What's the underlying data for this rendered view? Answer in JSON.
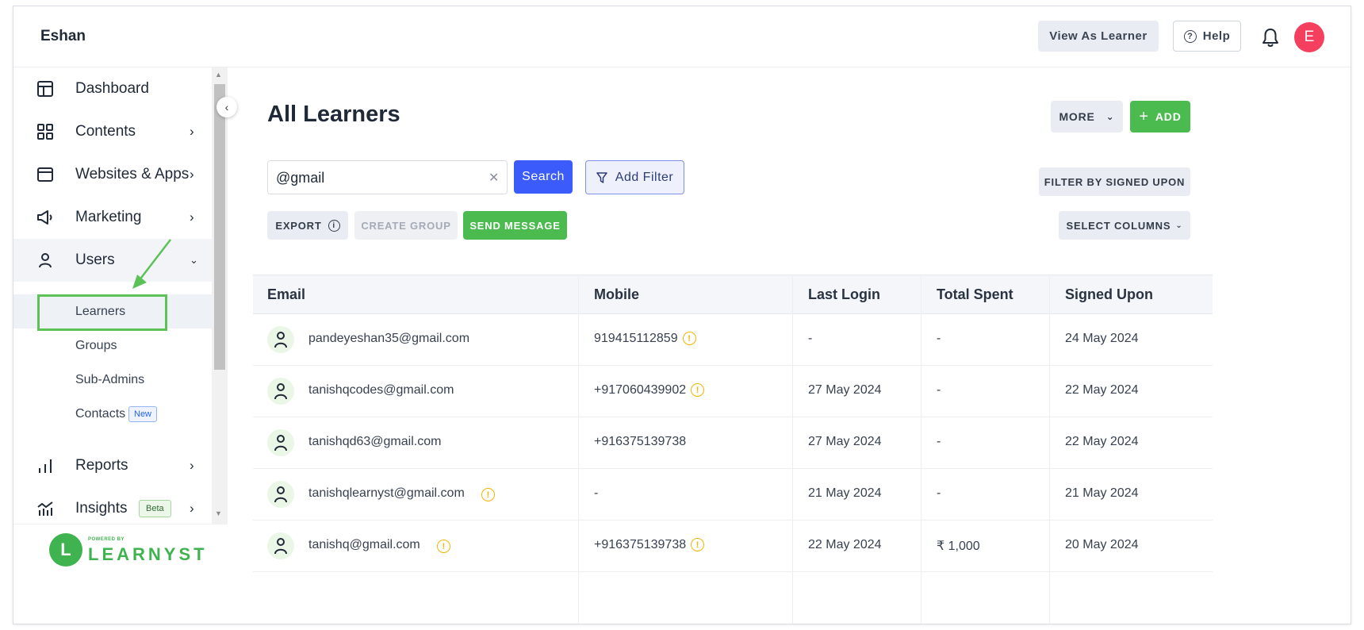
{
  "topbar": {
    "brand": "Eshan",
    "view_as_learner": "View As Learner",
    "help": "Help",
    "avatar_letter": "E"
  },
  "sidebar": {
    "items": [
      {
        "label": "Dashboard",
        "icon": "layout-icon"
      },
      {
        "label": "Contents",
        "icon": "grid-icon"
      },
      {
        "label": "Websites & Apps",
        "icon": "browser-icon"
      },
      {
        "label": "Marketing",
        "icon": "megaphone-icon"
      },
      {
        "label": "Users",
        "icon": "user-icon"
      },
      {
        "label": "Reports",
        "icon": "bar-chart-icon"
      },
      {
        "label": "Insights",
        "icon": "insights-icon"
      }
    ],
    "users_sub": [
      "Learners",
      "Groups",
      "Sub-Admins",
      "Contacts"
    ],
    "new_badge": "New",
    "beta_badge": "Beta",
    "powered_by": "POWERED BY",
    "logo_text": "LEARNYST",
    "logo_letter": "L"
  },
  "main": {
    "title": "All Learners",
    "more_label": "MORE",
    "add_label": "ADD",
    "search_value": "@gmail",
    "search_button": "Search",
    "add_filter": "Add Filter",
    "filter_by_signed": "FILTER BY SIGNED UPON",
    "export": "EXPORT",
    "create_group": "CREATE GROUP",
    "send_message": "SEND MESSAGE",
    "select_columns": "SELECT COLUMNS"
  },
  "table": {
    "headers": [
      "Email",
      "Mobile",
      "Last Login",
      "Total Spent",
      "Signed Upon"
    ],
    "rows": [
      {
        "email": "pandeyeshan35@gmail.com",
        "mobile": "919415112859",
        "last_login": "-",
        "total_spent": "-",
        "signed_upon": "24 May 2024"
      },
      {
        "email": "tanishqcodes@gmail.com",
        "mobile": "+917060439902",
        "last_login": "27 May 2024",
        "total_spent": "-",
        "signed_upon": "22 May 2024"
      },
      {
        "email": "tanishqd63@gmail.com",
        "mobile": "+916375139738",
        "last_login": "27 May 2024",
        "total_spent": "-",
        "signed_upon": "22 May 2024"
      },
      {
        "email": "tanishqlearnyst@gmail.com",
        "mobile": "-",
        "last_login": "21 May 2024",
        "total_spent": "-",
        "signed_upon": "21 May 2024"
      },
      {
        "email": "tanishq@gmail.com",
        "mobile": "+916375139738",
        "last_login": "22 May 2024",
        "total_spent": "₹ 1,000",
        "signed_upon": "20 May 2024"
      }
    ]
  },
  "colors": {
    "accent_blue": "#3b5bfa",
    "accent_green": "#4cbb4f",
    "warning": "#f5b400",
    "avatar_red": "#f43f5e"
  }
}
